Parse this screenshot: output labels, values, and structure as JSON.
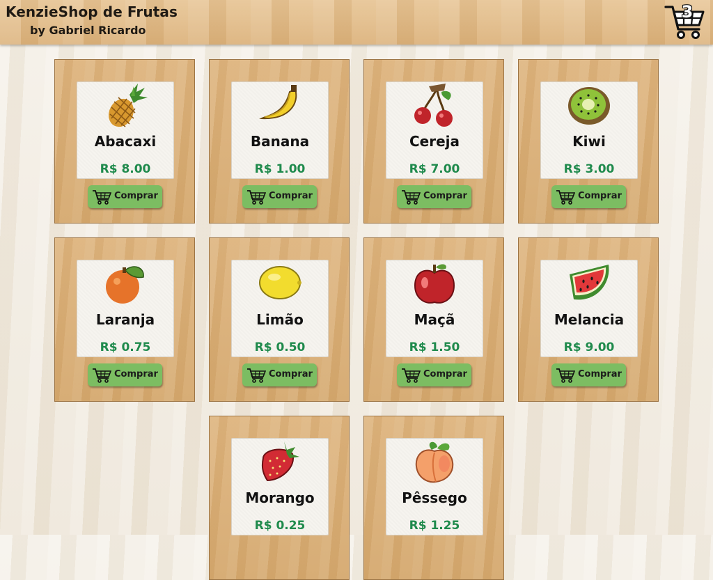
{
  "header": {
    "title": "KenzieShop de Frutas",
    "author": "by Gabriel Ricardo",
    "cart_count": "3",
    "cart_icon": "shopping-cart-icon"
  },
  "buy_label": "Comprar",
  "products": [
    {
      "name": "Abacaxi",
      "price": "R$ 8.00",
      "icon": "pineapple-icon"
    },
    {
      "name": "Banana",
      "price": "R$ 1.00",
      "icon": "banana-icon"
    },
    {
      "name": "Cereja",
      "price": "R$ 7.00",
      "icon": "cherry-icon"
    },
    {
      "name": "Kiwi",
      "price": "R$ 3.00",
      "icon": "kiwi-icon"
    },
    {
      "name": "Laranja",
      "price": "R$ 0.75",
      "icon": "orange-icon"
    },
    {
      "name": "Limão",
      "price": "R$ 0.50",
      "icon": "lemon-icon"
    },
    {
      "name": "Maçã",
      "price": "R$ 1.50",
      "icon": "apple-icon"
    },
    {
      "name": "Melancia",
      "price": "R$ 9.00",
      "icon": "watermelon-icon"
    },
    {
      "name": "Morango",
      "price": "R$ 0.25",
      "icon": "strawberry-icon"
    },
    {
      "name": "Pêssego",
      "price": "R$ 1.25",
      "icon": "peach-icon"
    }
  ],
  "colors": {
    "price": "#1f8a4c",
    "button": "#7cbd62",
    "card": "#dbb17a"
  }
}
